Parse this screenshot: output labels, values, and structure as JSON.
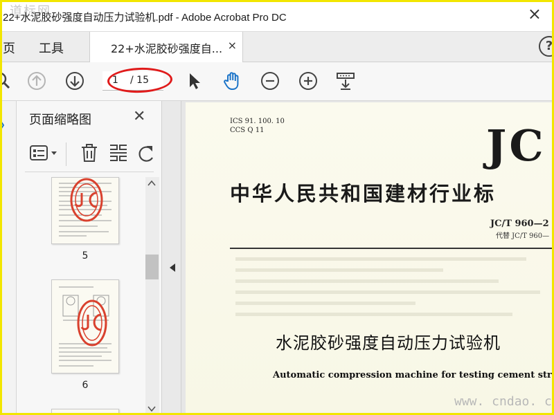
{
  "window": {
    "watermark": "道标网",
    "title": "22+水泥胶砂强度自动压力试验机.pdf - Adobe Acrobat Pro DC",
    "close_glyph": "×"
  },
  "tabs": {
    "home_label": "页",
    "tools_label": "工具",
    "doc_label": "22+水泥胶砂强度自...",
    "doc_close": "×",
    "help": "?"
  },
  "toolbar": {
    "current_page": "1",
    "total_pages": "/ 15"
  },
  "thumbnail_panel": {
    "title": "页面缩略图",
    "close": "✕",
    "pages": [
      {
        "label": "5"
      },
      {
        "label": "6"
      }
    ]
  },
  "document": {
    "ics": "ICS 91. 100. 10",
    "ccs": "CCS Q 11",
    "code_big": "JC",
    "standard_org": "中华人民共和国建材行业标",
    "standard_no": "JC/T 960—2",
    "replaces": "代替 JC/T 960—",
    "title_cn": "水泥胶砂强度自动压力试验机",
    "title_en": "Automatic compression machine for testing cement strength"
  },
  "watermark_bottom": "www. cndao. com",
  "colors": {
    "frame": "#f2e600",
    "highlight": "#e01b1b",
    "hand_tool": "#1a73c8"
  }
}
